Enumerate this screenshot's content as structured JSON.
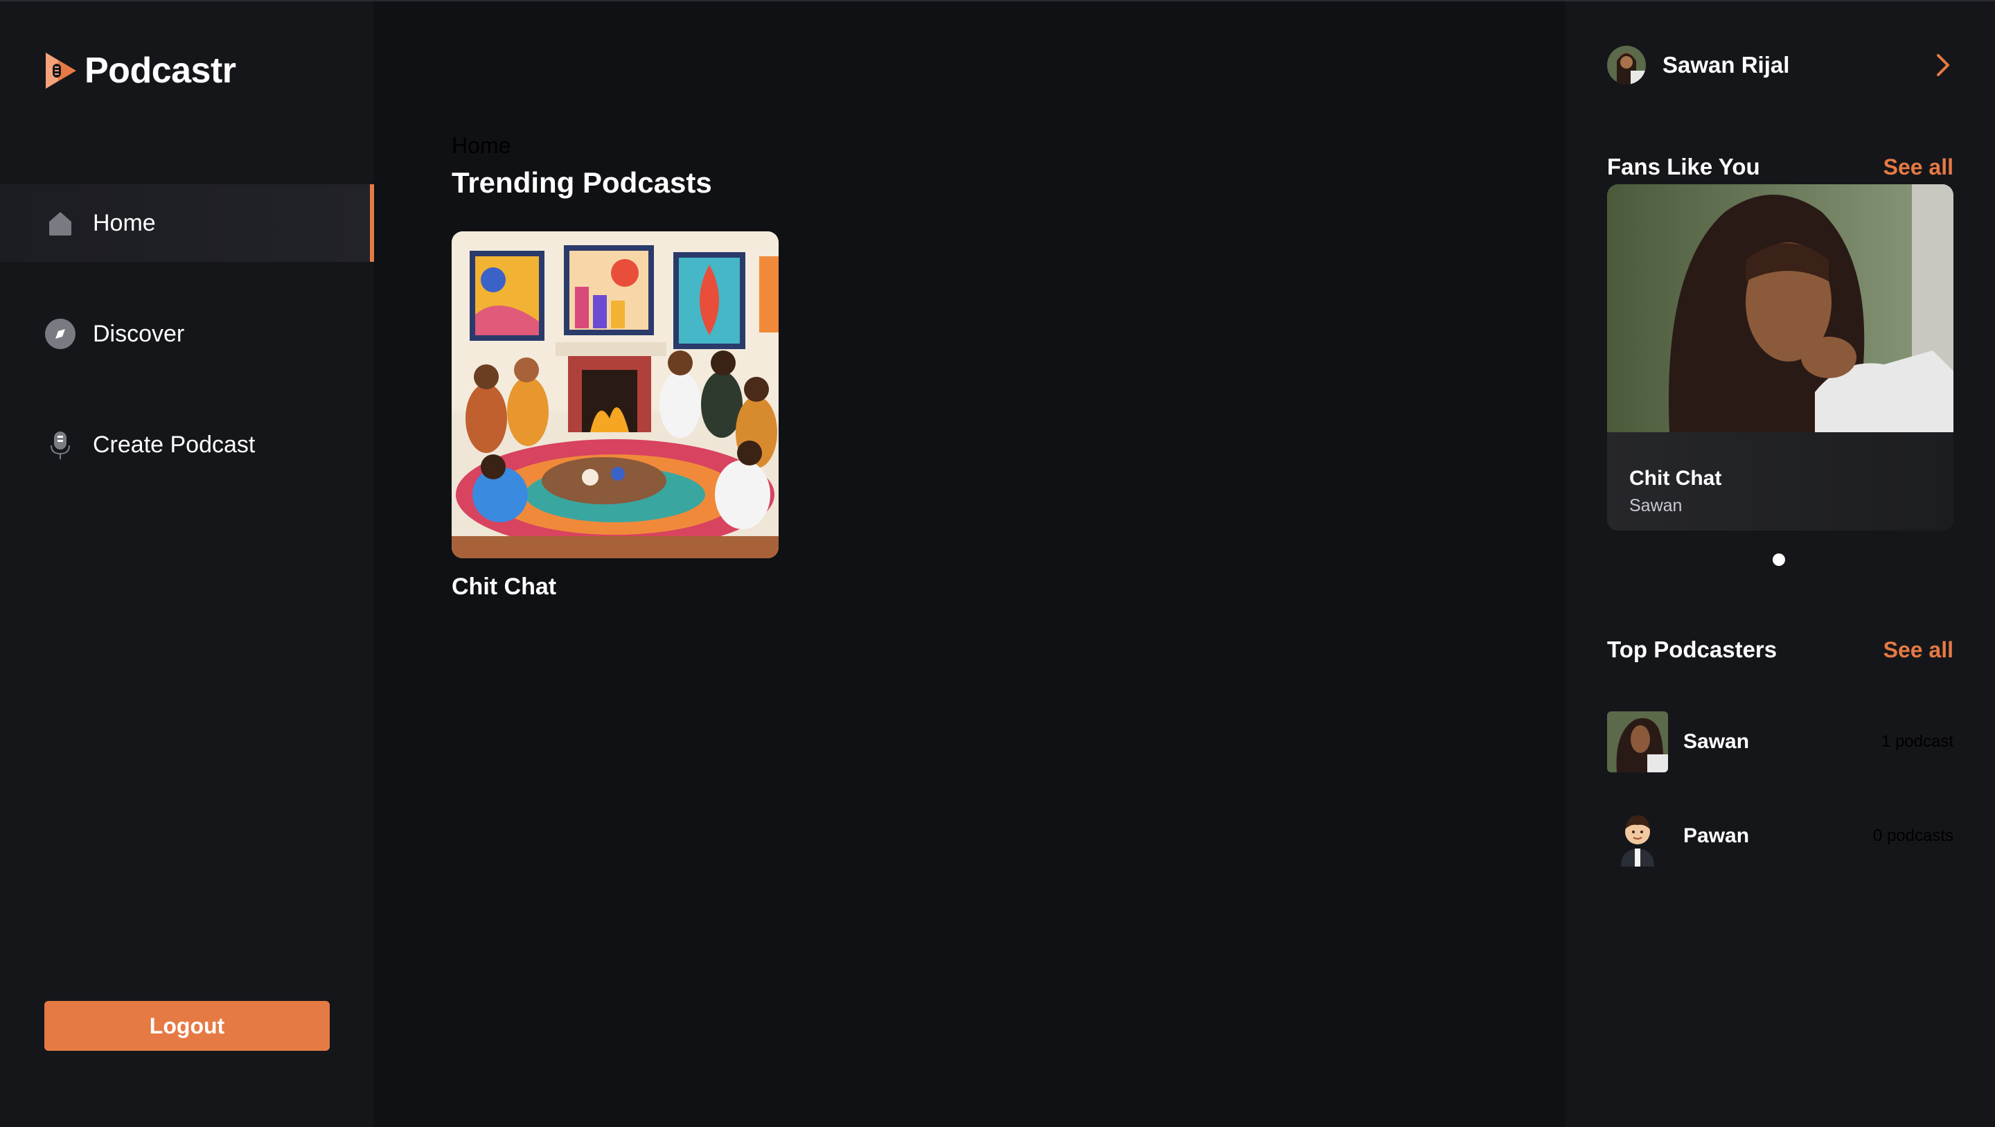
{
  "brand": {
    "name": "Podcastr",
    "accent": "#e57a44"
  },
  "sidebar": {
    "items": [
      {
        "label": "Home",
        "icon": "home-icon",
        "active": true
      },
      {
        "label": "Discover",
        "icon": "compass-icon",
        "active": false
      },
      {
        "label": "Create Podcast",
        "icon": "microphone-icon",
        "active": false
      }
    ],
    "logout_label": "Logout"
  },
  "main": {
    "breadcrumb": "Home",
    "section_title": "Trending Podcasts",
    "podcasts": [
      {
        "title": "Chit Chat"
      }
    ]
  },
  "rightbar": {
    "user_name": "Sawan Rijal",
    "fans": {
      "title": "Fans Like You",
      "see_all": "See all",
      "featured": {
        "title": "Chit Chat",
        "author": "Sawan"
      }
    },
    "top": {
      "title": "Top Podcasters",
      "see_all": "See all",
      "podcasters": [
        {
          "name": "Sawan",
          "count": "1 podcast"
        },
        {
          "name": "Pawan",
          "count": "0 podcasts"
        }
      ]
    }
  }
}
